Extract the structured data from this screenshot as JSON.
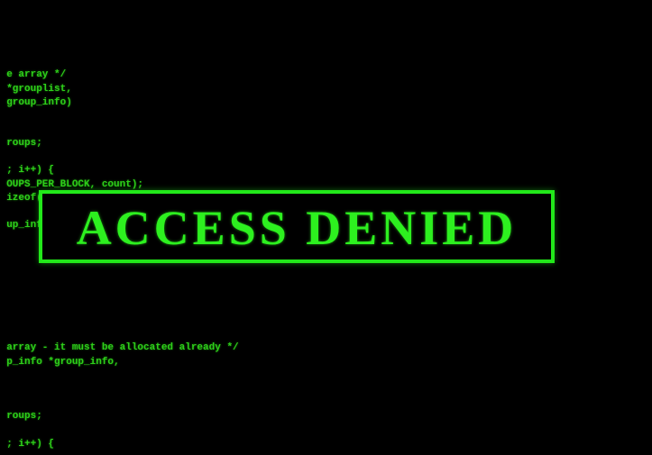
{
  "colors": {
    "background": "#000000",
    "code_text": "#2ecf1a",
    "alert_border": "#22e81a",
    "alert_text": "#2df01f"
  },
  "code_lines": [
    "  e array */",
    "  *grouplist,",
    "  group_info)",
    "  roups;",
    "  ; i++) {",
    "  OUPS_PER_BLOCK, count);",
    "  izeof(",
    "  up_info",
    "  array - it must be allocated already */",
    "  p_info *group_info,",
    "  roups;",
    "  ; i++) {"
  ],
  "alert": {
    "message": "ACCESS DENIED"
  }
}
